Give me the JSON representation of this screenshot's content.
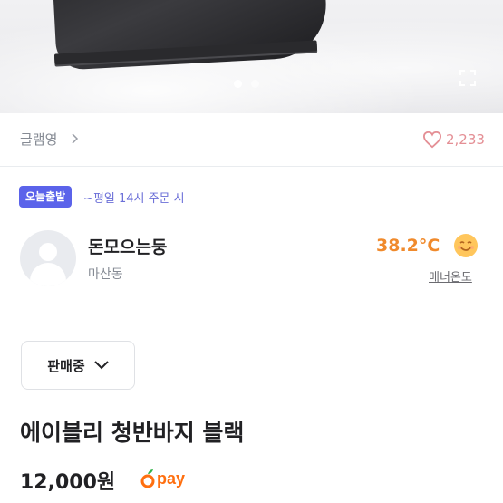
{
  "gallery": {
    "slide_count": 2,
    "active_slide": 1
  },
  "store": {
    "name": "글램영"
  },
  "likes": {
    "count": "2,233"
  },
  "shipping": {
    "badge": "오늘출발",
    "note": "~평일 14시 주문 시"
  },
  "seller": {
    "nickname": "돈모으는둥",
    "location": "마산동",
    "temperature": "38.2°C",
    "manner_label": "매너온도"
  },
  "status": {
    "label": "판매중"
  },
  "product": {
    "title": "에이블리 청반바지 블랙",
    "price": "12,000원"
  },
  "pay": {
    "label": "pay"
  },
  "colors": {
    "badge": "#5b63ea",
    "temperature": "#f08a2c",
    "like": "#e48f95",
    "pay": "#ff6f0f"
  }
}
